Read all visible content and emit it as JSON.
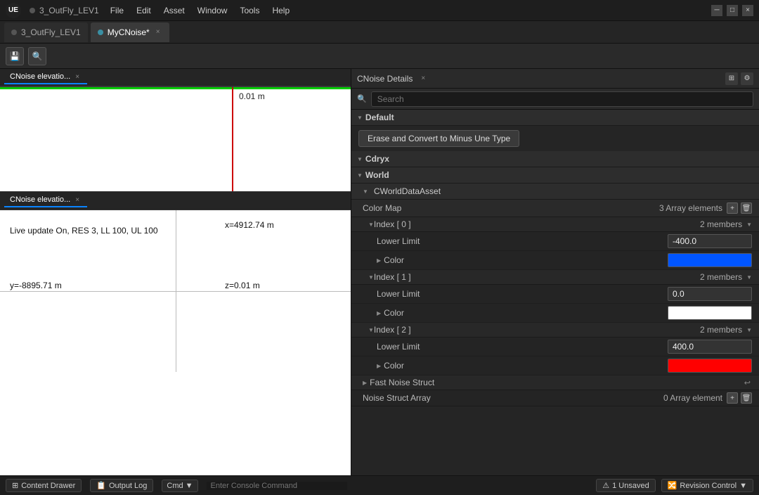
{
  "titlebar": {
    "logo": "UE",
    "project": "3_OutFly_LEV1",
    "asset_tab": "MyCNoise*",
    "close_label": "×",
    "minimize_label": "─",
    "maximize_label": "□"
  },
  "menu": {
    "items": [
      "File",
      "Edit",
      "Asset",
      "Window",
      "Tools",
      "Help"
    ]
  },
  "toolbar": {
    "save_icon": "💾",
    "browse_icon": "🔍"
  },
  "viewport_top_tab": {
    "label": "CNoise elevatio...",
    "close": "×"
  },
  "viewport_top": {
    "coord_label": "0.01 m"
  },
  "viewport_bottom_tab": {
    "label": "CNoise elevatio...",
    "close": "×"
  },
  "viewport_bottom": {
    "live_update": "Live update On, RES 3, LL 100, UL 100",
    "coord_y": "y=-8895.71 m",
    "coord_x": "x=4912.74 m",
    "coord_z": "z=0.01 m"
  },
  "details_panel": {
    "title": "CNoise Details",
    "close": "×",
    "search_placeholder": "Search"
  },
  "sections": {
    "default": "Default",
    "erase_button": "Erase and Convert to Minus Une Type",
    "cdryx": "Cdryx",
    "world": "World",
    "world_data_asset": "CWorldDataAsset",
    "color_map": "Color Map",
    "color_map_count": "3 Array elements",
    "index0": "Index [ 0 ]",
    "index0_members": "2 members",
    "lower_limit_0": "Lower Limit",
    "lower_limit_0_value": "-400.0",
    "color_0": "Color",
    "index1": "Index [ 1 ]",
    "index1_members": "2 members",
    "lower_limit_1": "Lower Limit",
    "lower_limit_1_value": "0.0",
    "color_1": "Color",
    "index2": "Index [ 2 ]",
    "index2_members": "2 members",
    "lower_limit_2": "Lower Limit",
    "lower_limit_2_value": "400.0",
    "color_2": "Color",
    "fast_noise_struct": "Fast Noise Struct",
    "noise_struct_array": "Noise Struct Array",
    "noise_struct_array_count": "0 Array element"
  },
  "status_bar": {
    "content_drawer": "Content Drawer",
    "output_log": "Output Log",
    "cmd": "Cmd",
    "console_placeholder": "Enter Console Command",
    "unsaved": "1 Unsaved",
    "revision_control": "Revision Control"
  }
}
